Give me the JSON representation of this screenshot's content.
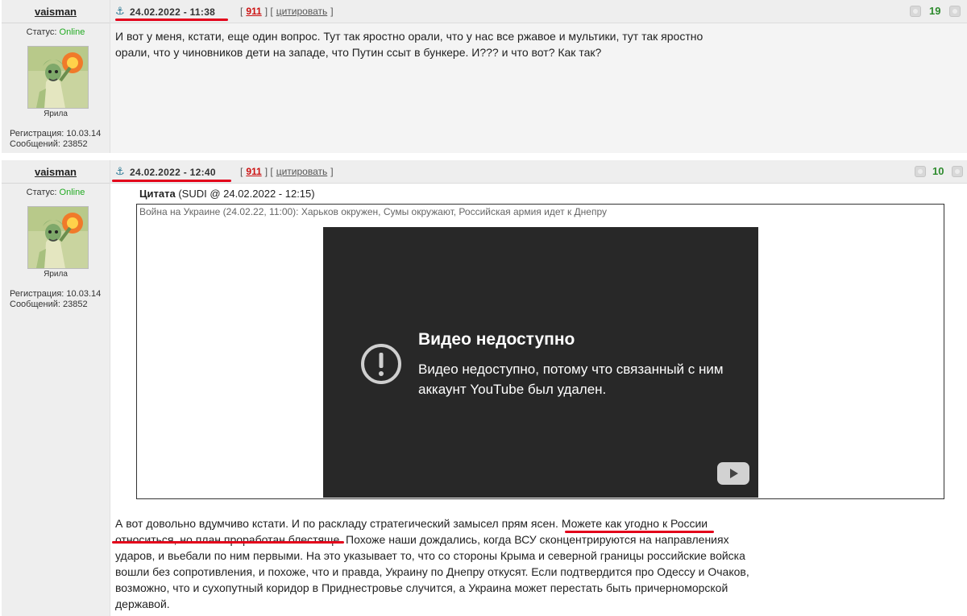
{
  "posts": [
    {
      "author": "vaisman",
      "status_label": "Статус:",
      "status_value": "Online",
      "rank": "Ярила",
      "registration": "Регистрация: 10.03.14",
      "messages": "Сообщений: 23852",
      "date": "24.02.2022 - 11:38",
      "num": "911",
      "cite": "цитировать",
      "rating": "19",
      "text": "И вот у меня, кстати, еще один вопрос. Тут так яростно орали, что у нас все ржавое и мультики, тут так яростно орали, что у чиновников дети на западе, что Путин ссыт в бункере. И??? и что вот? Как так?"
    },
    {
      "author": "vaisman",
      "status_label": "Статус:",
      "status_value": "Online",
      "rank": "Ярила",
      "registration": "Регистрация: 10.03.14",
      "messages": "Сообщений: 23852",
      "date": "24.02.2022 - 12:40",
      "num": "911",
      "cite": "цитировать",
      "rating": "10",
      "quote": {
        "label": "Цитата",
        "source": "(SUDI @ 24.02.2022 - 12:15)",
        "text": "Война на Украине (24.02.22, 11:00): Харьков окружен, Сумы окружают, Российская армия идет к Днепру",
        "video_title": "Видео недоступно",
        "video_message": "Видео недоступно, потому что связанный с ним аккаунт YouTube был удален."
      },
      "text_before": "А вот довольно вдумчиво кстати. И по раскладу стратегический замысел прям ясен.",
      "text_highlight": "Можете как угодно к России относиться, но план проработан блестяще.",
      "text_after": "Похоже наши дождались, когда ВСУ сконцентрируются на направлениях ударов, и вьебали по ним первыми. На это указывает то, что со стороны Крыма и северной границы российские войска вошли без сопротивления, и похоже, что и правда, Украину по Днепру откусят. Если подтвердится про Одессу и Очаков, возможно, что и сухопутный коридор в Приднестровье случится, а Украина может перестать быть причерноморской державой."
    }
  ],
  "colors": {
    "online": "#22aa22",
    "rating": "#2e8b2e",
    "post_number": "#cc1111",
    "annotation": "#e3001a",
    "video_bg": "#282828"
  },
  "icons": {
    "anchor": "anchor-icon",
    "rate_down": "rate-down-icon",
    "rate_up": "rate-up-icon",
    "video_error": "exclamation-circle-icon",
    "youtube": "youtube-icon"
  }
}
